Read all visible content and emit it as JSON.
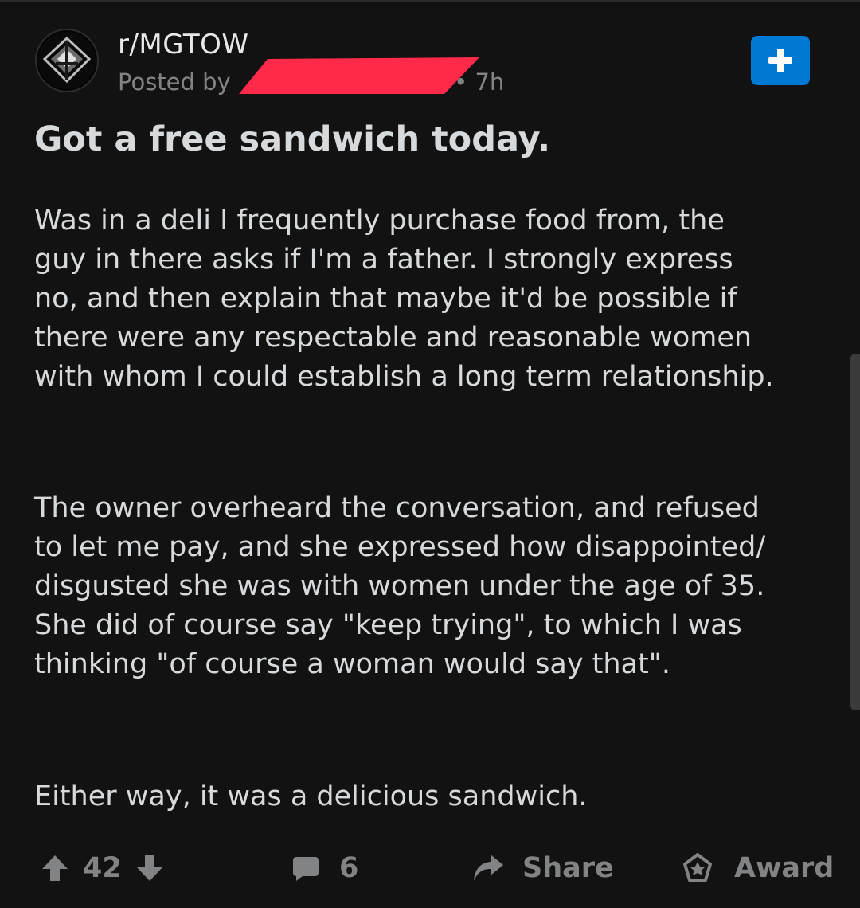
{
  "post": {
    "subreddit": "r/MGTOW",
    "posted_by_prefix": "Posted by",
    "author_redacted": "",
    "age": "• 7h",
    "title": "Got a free sandwich today.",
    "paragraphs": [
      [
        "Was in a deli I frequently purchase food from, the",
        "guy in there asks if I'm a father.  I strongly express",
        "no, and then explain that maybe it'd be possible if",
        "there were any respectable and reasonable women",
        "with whom I could establish a long term relationship."
      ],
      [
        "The owner overheard the conversation, and refused",
        "to let me pay, and she expressed how disappointed/",
        "disgusted she was with women under the age of 35.",
        "She did of course say \"keep trying\", to which I was",
        "thinking \"of course a woman would say that\"."
      ],
      [
        "Either way, it was a delicious sandwich."
      ]
    ]
  },
  "actions": {
    "score": "42",
    "comments": "6",
    "share_label": "Share",
    "award_label": "Award"
  },
  "icons": {
    "avatar": "subreddit-avatar-icon",
    "join": "plus-icon",
    "upvote": "upvote-arrow-icon",
    "downvote": "downvote-arrow-icon",
    "comment": "comment-bubble-icon",
    "share": "share-arrow-icon",
    "award": "award-star-icon"
  },
  "colors": {
    "background": "#121212",
    "text": "#d7dadc",
    "muted": "#818384",
    "accent": "#0079d3",
    "redaction": "#ff2a4a"
  }
}
